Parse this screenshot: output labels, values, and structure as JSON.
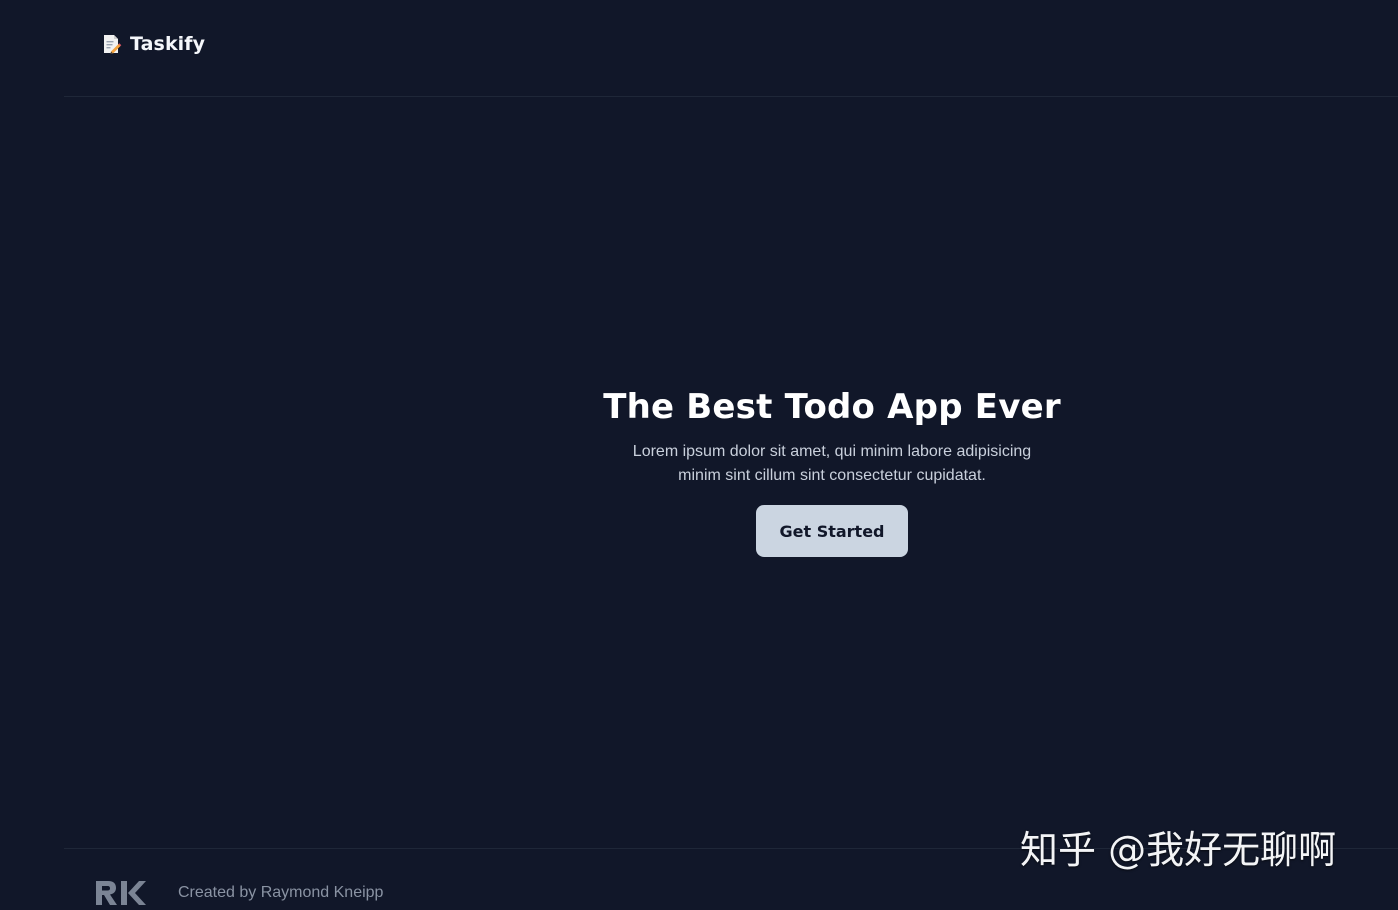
{
  "header": {
    "brand_name": "Taskify",
    "brand_icon": "memo-icon"
  },
  "hero": {
    "title": "The Best Todo App Ever",
    "description": "Lorem ipsum dolor sit amet, qui minim labore adipisicing minim sint cillum sint consectetur cupidatat.",
    "cta_label": "Get Started"
  },
  "footer": {
    "logo_icon": "rk-logo-icon",
    "credit": "Created by Raymond Kneipp"
  },
  "watermark": {
    "text": "知乎 @我好无聊啊"
  },
  "colors": {
    "background": "#111729",
    "divider": "#1f2738",
    "button_bg": "#cbd5e1",
    "title_text": "#ffffff",
    "body_text": "#c9d0dc",
    "muted_text": "#8a93a3"
  }
}
